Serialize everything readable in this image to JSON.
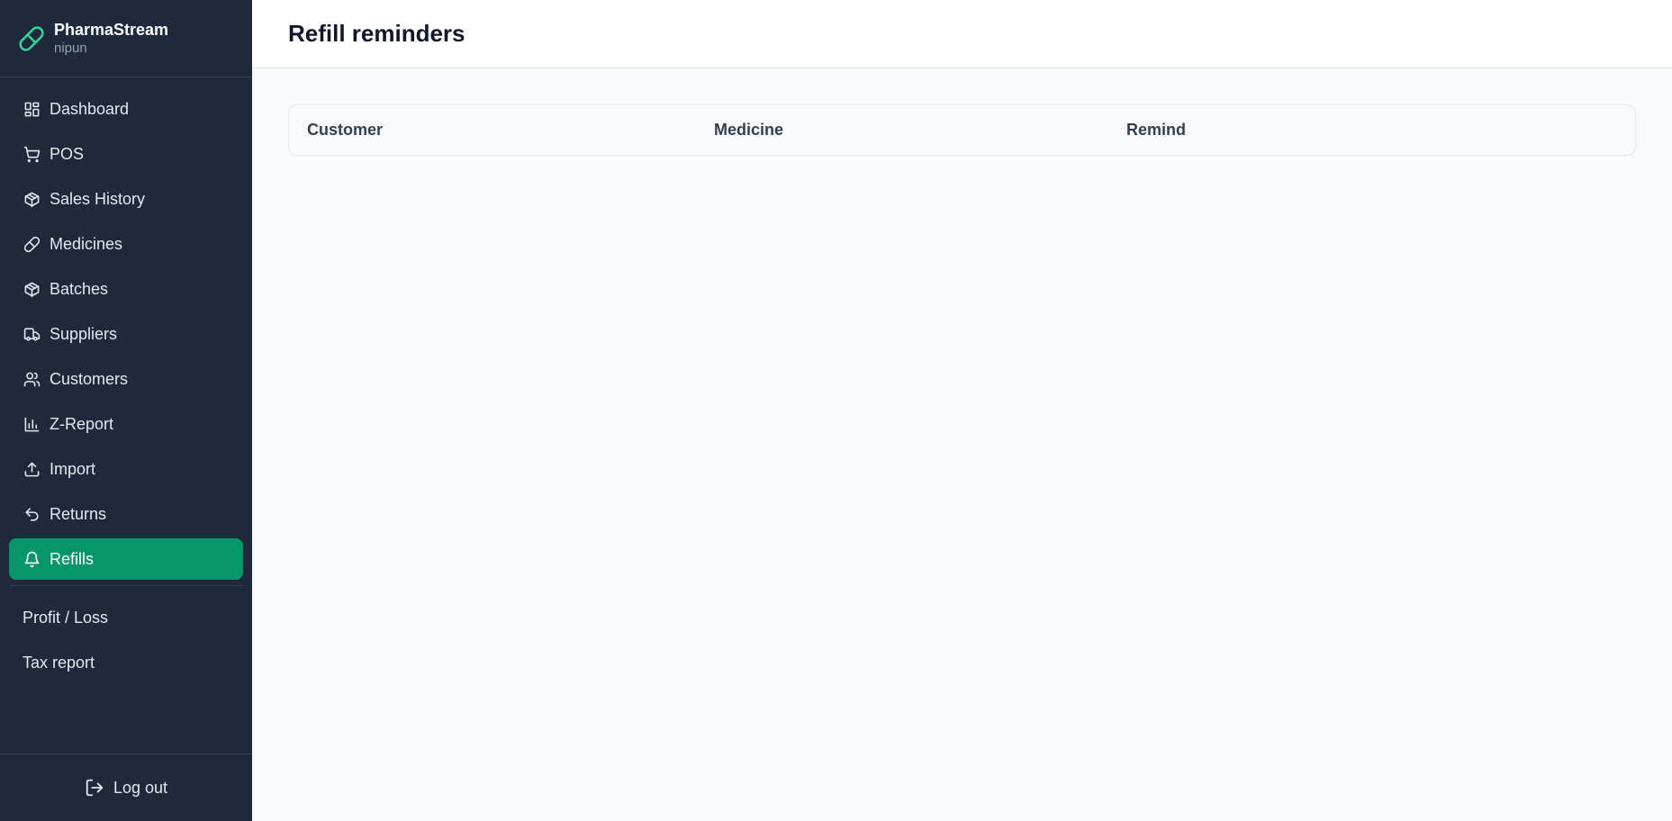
{
  "brand": {
    "name": "PharmaStream",
    "user": "nipun",
    "accent": "#34d399"
  },
  "sidebar": {
    "items": [
      {
        "label": "Dashboard",
        "icon": "dashboard-icon"
      },
      {
        "label": "POS",
        "icon": "cart-icon"
      },
      {
        "label": "Sales History",
        "icon": "package-icon"
      },
      {
        "label": "Medicines",
        "icon": "pill-icon"
      },
      {
        "label": "Batches",
        "icon": "package-icon"
      },
      {
        "label": "Suppliers",
        "icon": "truck-icon"
      },
      {
        "label": "Customers",
        "icon": "users-icon"
      },
      {
        "label": "Z-Report",
        "icon": "bar-chart-icon"
      },
      {
        "label": "Import",
        "icon": "upload-icon"
      },
      {
        "label": "Returns",
        "icon": "undo-icon"
      },
      {
        "label": "Refills",
        "icon": "bell-icon",
        "active": true
      }
    ],
    "secondary": [
      {
        "label": "Profit / Loss"
      },
      {
        "label": "Tax report"
      }
    ],
    "logout_label": "Log out",
    "background": "#1e293b",
    "active_color": "#059669"
  },
  "header": {
    "title": "Refill reminders"
  },
  "table": {
    "columns": [
      "Customer",
      "Medicine",
      "Remind"
    ],
    "rows": []
  }
}
